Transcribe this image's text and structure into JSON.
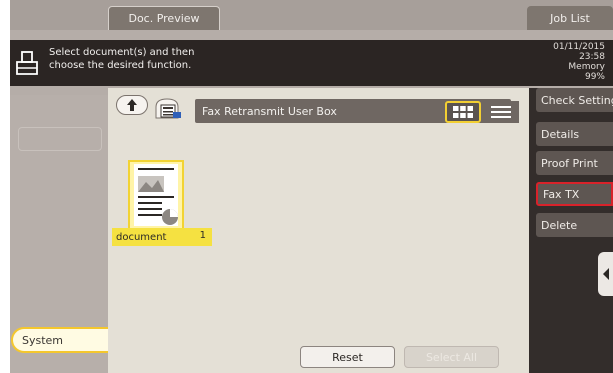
{
  "header": {
    "preview_tab": "Doc. Preview",
    "joblist_tab": "Job List"
  },
  "message": {
    "line1": "Select document(s) and then",
    "line2": "choose the desired function.",
    "date": "01/11/2015",
    "time": "23:58",
    "memory_label": "Memory",
    "memory_value": "99%"
  },
  "left": {
    "system_tab": "System"
  },
  "main": {
    "path": "Fax Retransmit User Box",
    "document": {
      "name": "document",
      "count": "1"
    },
    "reset_button": "Reset",
    "select_all_button": "Select All"
  },
  "right_menu": {
    "items": [
      {
        "label": "Check Setting"
      },
      {
        "label": "Details"
      },
      {
        "label": "Proof Print"
      },
      {
        "label": "Fax TX"
      },
      {
        "label": "Delete"
      }
    ]
  },
  "colors": {
    "highlight": "#d8222a",
    "selection": "#f2cf33",
    "panel_dark": "#332d2b"
  }
}
